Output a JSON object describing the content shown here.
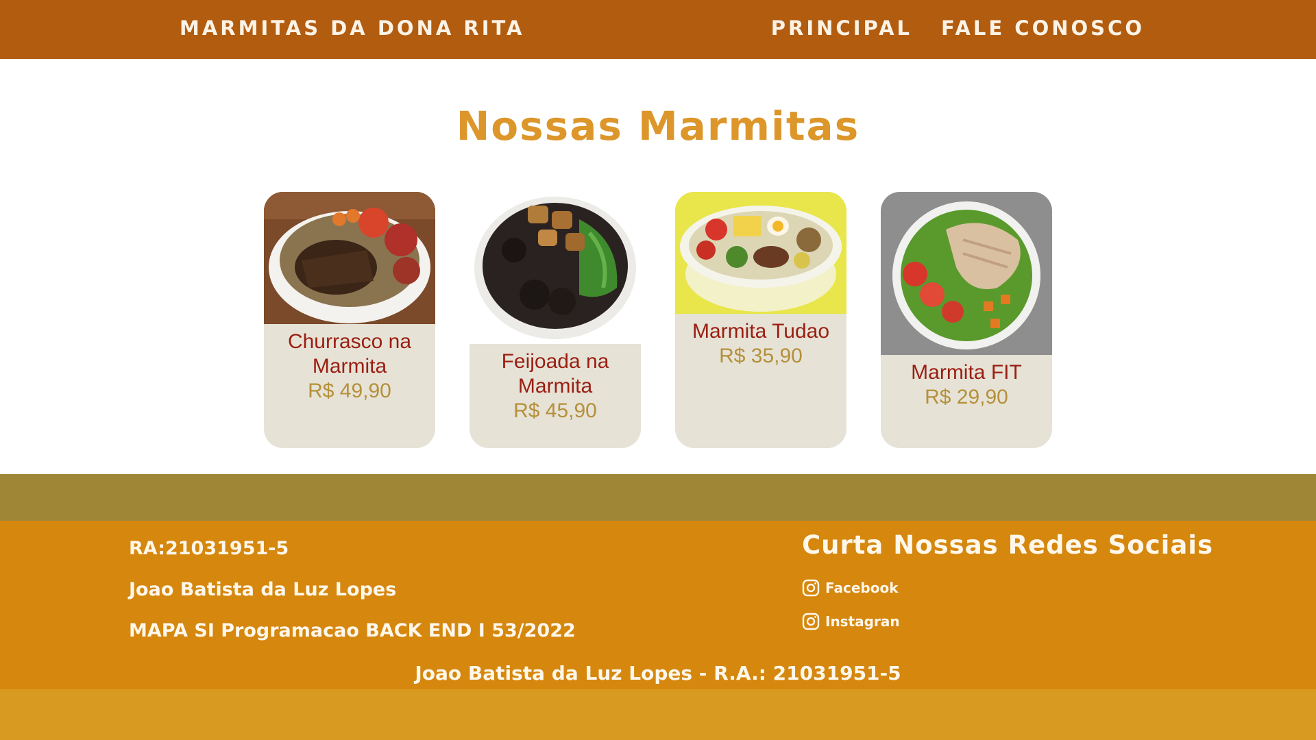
{
  "header": {
    "brand": "MARMITAS DA DONA RITA",
    "nav": [
      {
        "label": "PRINCIPAL"
      },
      {
        "label": "FALE CONOSCO"
      }
    ]
  },
  "main": {
    "title": "Nossas Marmitas",
    "products": [
      {
        "name": "Churrasco na Marmita",
        "price": "R$ 49,90"
      },
      {
        "name": "Feijoada na Marmita",
        "price": "R$ 45,90"
      },
      {
        "name": "Marmita Tudao",
        "price": "R$ 35,90"
      },
      {
        "name": "Marmita FIT",
        "price": "R$ 29,90"
      }
    ]
  },
  "footer": {
    "info": [
      "RA:21031951-5",
      "Joao Batista da Luz Lopes",
      "MAPA SI Programacao BACK END I 53/2022"
    ],
    "social_title": "Curta Nossas Redes Sociais",
    "social_links": [
      {
        "label": "Facebook",
        "icon": "instagram-icon"
      },
      {
        "label": "Instagran",
        "icon": "instagram-icon"
      }
    ],
    "credit": "Joao Batista da Luz Lopes - R.A.: 21031951-5"
  },
  "colors": {
    "header": "#b25c10",
    "title": "#dd962a",
    "card": "#e6e2d6",
    "product_name": "#9a1e12",
    "price": "#b5903a",
    "band": "#9f8636",
    "footer": "#d5870e",
    "footer_bottom": "#d99a21"
  }
}
